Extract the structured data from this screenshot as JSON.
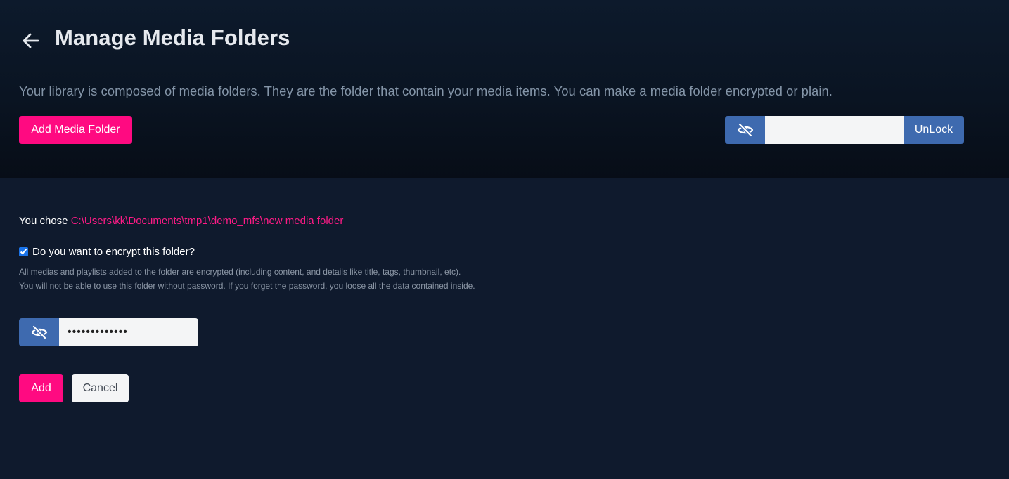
{
  "header": {
    "title": "Manage Media Folders",
    "intro": "Your library is composed of media folders. They are the folder that contain your media items. You can make a media folder encrypted or plain.",
    "add_folder_label": "Add Media Folder",
    "unlock": {
      "icon": "eye-slash-icon",
      "input_value": "",
      "button_label": "UnLock"
    }
  },
  "form": {
    "chose_prefix": "You chose",
    "chosen_path": "C:\\Users\\kk\\Documents\\tmp1\\demo_mfs\\new media folder",
    "encrypt_checked": true,
    "encrypt_label": "Do you want to encrypt this folder?",
    "help_line_1": "All medias and playlists added to the folder are encrypted (including content, and details like title, tags, thumbnail, etc).",
    "help_line_2": "You will not be able to use this folder without password. If you forget the password, you loose all the data contained inside.",
    "password": {
      "icon": "eye-slash-icon",
      "value": "•••••••••••••"
    },
    "add_label": "Add",
    "cancel_label": "Cancel"
  },
  "colors": {
    "accent_pink": "#ff0a81",
    "accent_blue": "#3e6aaf",
    "background": "#0f1a2d"
  }
}
